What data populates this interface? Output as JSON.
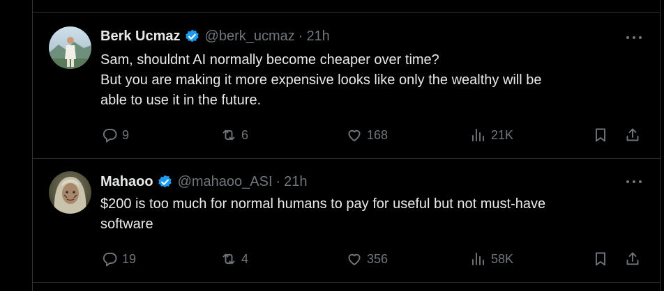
{
  "tweets": [
    {
      "author": {
        "name": "Berk Ucmaz",
        "handle": "@berk_ucmaz",
        "verified": true
      },
      "time": "21h",
      "text_lines": [
        "Sam, shouldnt AI normally become cheaper over time?",
        "But you are making it more expensive looks like only the wealthy will be",
        "able to use it in the future."
      ],
      "stats": {
        "replies": "9",
        "reposts": "6",
        "likes": "168",
        "views": "21K"
      }
    },
    {
      "author": {
        "name": "Mahaoo",
        "handle": "@mahaoo_ASI",
        "verified": true
      },
      "time": "21h",
      "text_lines": [
        "$200 is too much for normal humans to pay for useful but not must-have",
        "software"
      ],
      "stats": {
        "replies": "19",
        "reposts": "4",
        "likes": "356",
        "views": "58K"
      }
    }
  ],
  "separator": "·",
  "colors": {
    "background": "#000000",
    "text_primary": "#e7e9ea",
    "text_secondary": "#71767b",
    "border": "#2f3336",
    "verified_blue": "#1d9bf0"
  },
  "icons": [
    "verified-badge-icon",
    "more-icon",
    "reply-icon",
    "repost-icon",
    "like-icon",
    "views-icon",
    "bookmark-icon",
    "share-icon"
  ]
}
